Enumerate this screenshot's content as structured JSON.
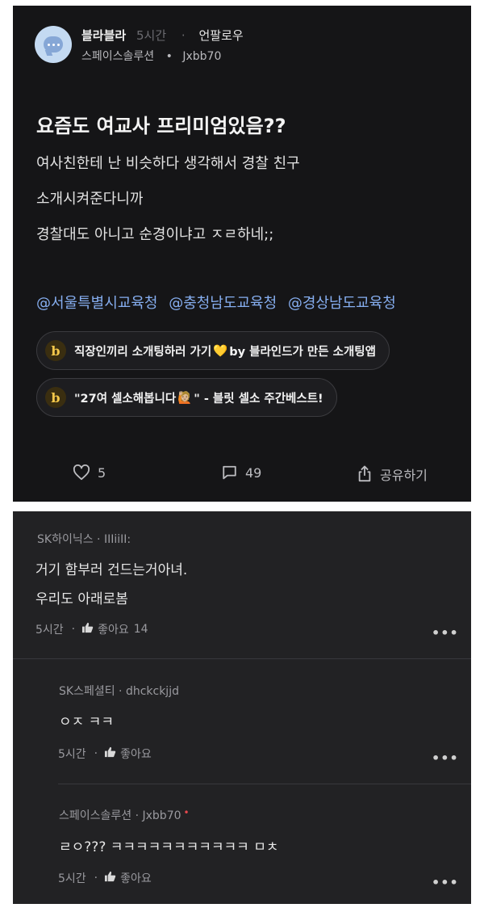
{
  "post": {
    "author": "블라블라",
    "time": "5시간",
    "separator": "·",
    "follow_label": "언팔로우",
    "company": "스페이스솔루션",
    "meta_separator": "•",
    "nickname": "Jxbb70",
    "title": "요즘도 여교사 프리미엄있음??",
    "body": [
      "여사친한테 난 비슷하다 생각해서 경찰 친구",
      "소개시켜준다니까",
      "경찰대도 아니고 순경이냐고 ㅈㄹ하네;;"
    ],
    "tags": [
      "@서울특별시교육청",
      "@충청남도교육청",
      "@경상남도교육청"
    ],
    "promos": [
      {
        "badge": "b",
        "text_before": "직장인끼리 소개팅하러 가기",
        "emoji": "💛",
        "text_after": " by 블라인드가 만든 소개팅앱"
      },
      {
        "badge": "b",
        "text_before": "\"27여 셀소해봅니다",
        "emoji": "🙋🏼",
        "text_after": "\" - 블릿 셀소 주간베스트!"
      }
    ],
    "likes": "5",
    "comments": "49",
    "share_label": "공유하기",
    "icons": {
      "like": "heart-icon",
      "comment": "comment-icon",
      "share": "share-icon"
    }
  },
  "comments": [
    {
      "author": "SK하이닉스 · IIIiiII:",
      "lines": [
        "거기 함부러 건드는거아녀.",
        "우리도 아래로봄"
      ],
      "time": "5시간",
      "like_label": "좋아요",
      "like_count": "14",
      "more": "•••"
    },
    {
      "author": "SK스페셜티 · dhckckjjd",
      "lines": [
        "ㅇㅈ ㅋㅋ"
      ],
      "time": "5시간",
      "like_label": "좋아요",
      "like_count": "",
      "more": "•••"
    },
    {
      "author": "스페이스솔루션 · Jxbb70",
      "author_badge": "•",
      "lines": [
        "ㄹㅇ??? ㅋㅋㅋㅋㅋㅋㅋㅋㅋㅋㅋ ㅁㅊ"
      ],
      "time": "5시간",
      "like_label": "좋아요",
      "like_count": "",
      "more": "•••"
    }
  ],
  "colors": {
    "background": "#151517",
    "comment_background": "#222224",
    "tag": "#86aef0",
    "accent_badge": "#f3c74a",
    "op_dot": "#e5484d"
  }
}
